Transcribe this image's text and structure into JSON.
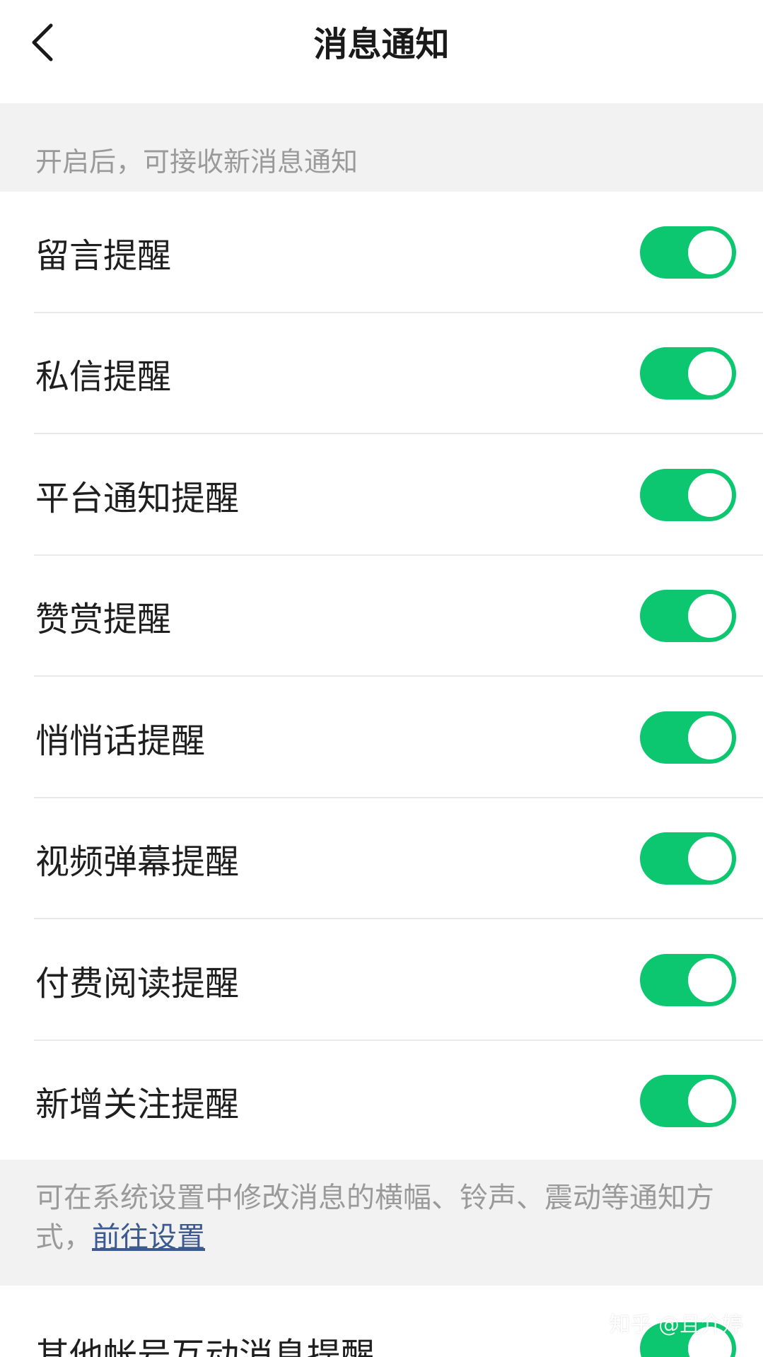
{
  "nav": {
    "title": "消息通知",
    "back_icon": "chevron-left-icon"
  },
  "section_header": "开启后，可接收新消息通知",
  "settings": [
    {
      "label": "留言提醒",
      "enabled": true
    },
    {
      "label": "私信提醒",
      "enabled": true
    },
    {
      "label": "平台通知提醒",
      "enabled": true
    },
    {
      "label": "赞赏提醒",
      "enabled": true
    },
    {
      "label": "悄悄话提醒",
      "enabled": true
    },
    {
      "label": "视频弹幕提醒",
      "enabled": true
    },
    {
      "label": "付费阅读提醒",
      "enabled": true
    },
    {
      "label": "新增关注提醒",
      "enabled": true
    }
  ],
  "note": {
    "text": "可在系统设置中修改消息的横幅、铃声、震动等通知方式，",
    "link": "前往设置"
  },
  "last_setting": {
    "label": "其他帐号互动消息提醒",
    "enabled": true
  },
  "watermark": "知乎 @且介婷",
  "colors": {
    "toggle_on": "#0cc76f",
    "section_bg": "#f2f2f2",
    "link": "#3c5a8f"
  }
}
